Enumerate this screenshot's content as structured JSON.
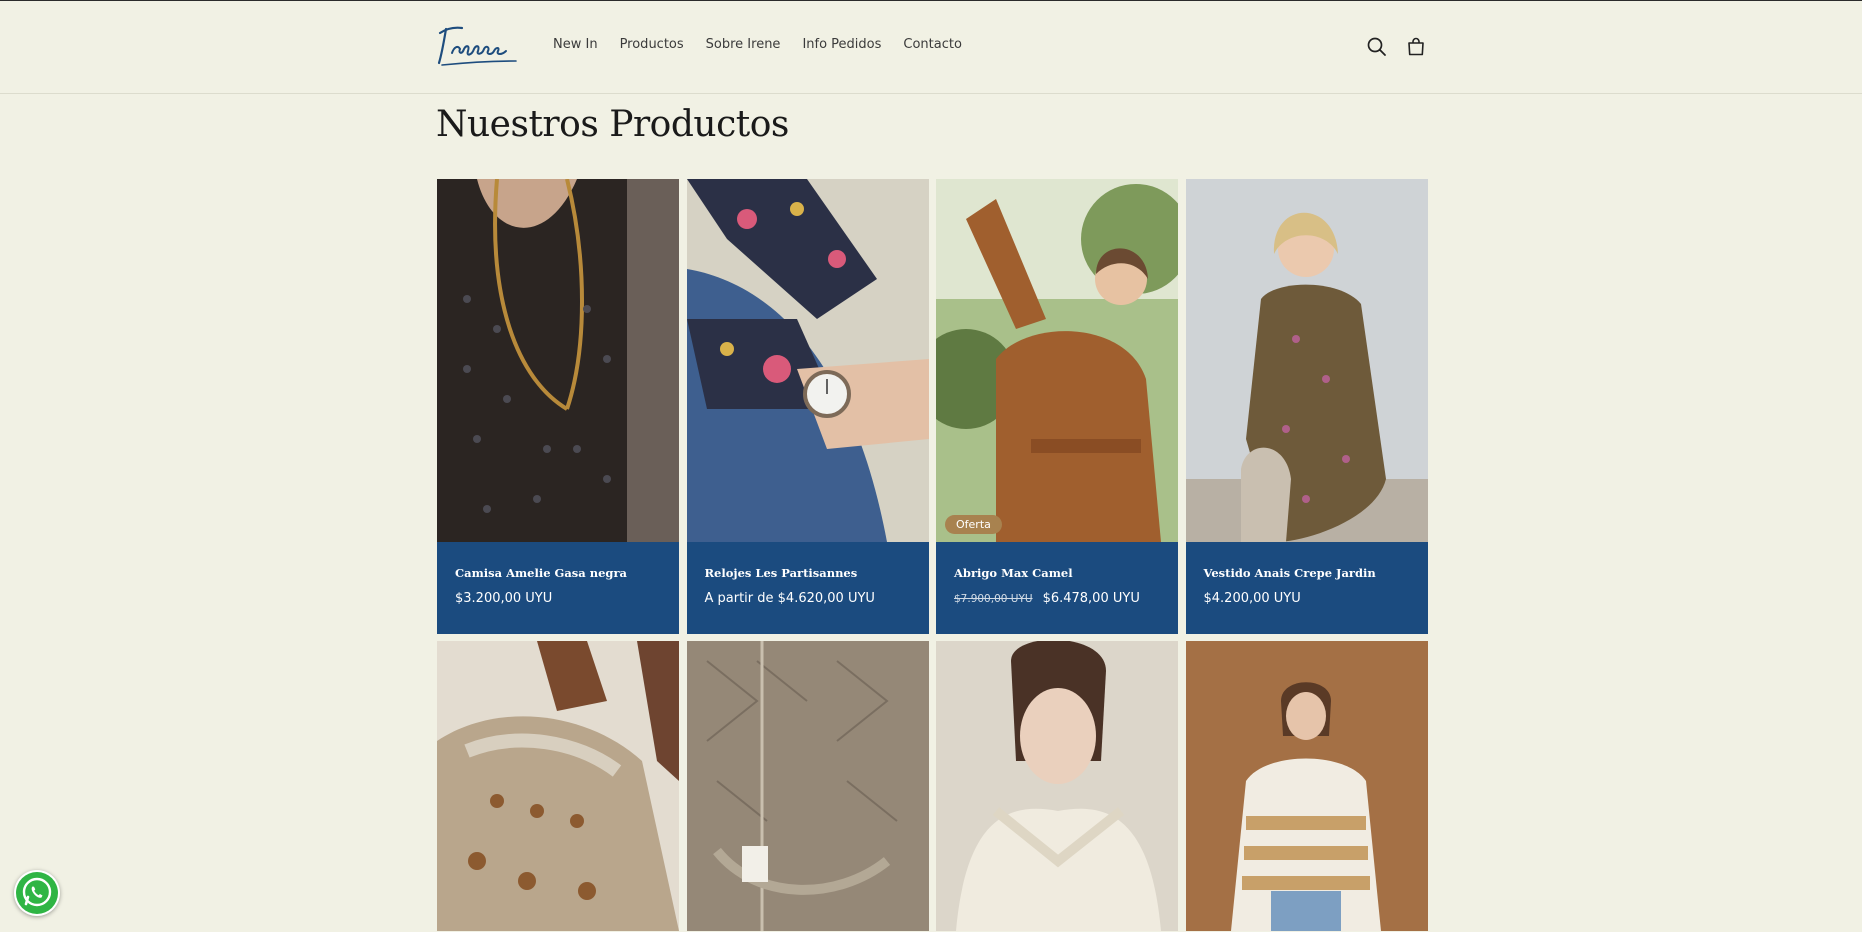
{
  "brand": {
    "logo_text": "Irene"
  },
  "nav": [
    "New In",
    "Productos",
    "Sobre Irene",
    "Info Pedidos",
    "Contacto"
  ],
  "page": {
    "title": "Nuestros Productos"
  },
  "products": [
    {
      "title": "Camisa Amelie Gasa negra",
      "price": "$3.200,00 UYU",
      "image": "black sheer polka-dot blouse with gold chain necklace"
    },
    {
      "title": "Relojes Les Partisannes",
      "price": "A partir de $4.620,00 UYU",
      "image": "wristwatch on floral sleeve over denim"
    },
    {
      "title": "Abrigo Max Camel",
      "old_price": "$7.900,00 UYU",
      "price": "$6.478,00 UYU",
      "badge": "Oferta",
      "image": "woman in camel belted coat"
    },
    {
      "title": "Vestido Anais Crepe Jardin",
      "price": "$4.200,00 UYU",
      "image": "woman in floral print dress"
    },
    {
      "image": "beige patterned knit sweater with brown boots"
    },
    {
      "image": "taupe pointelle knit cardigan"
    },
    {
      "image": "woman in cream cable knit cardigan"
    },
    {
      "image": "woman in striped cream knit sweater"
    }
  ],
  "colors": {
    "background": "#f1f1e4",
    "card_info": "#1b4b7f",
    "badge": "#a8824f",
    "logo": "#1e4d7e"
  }
}
